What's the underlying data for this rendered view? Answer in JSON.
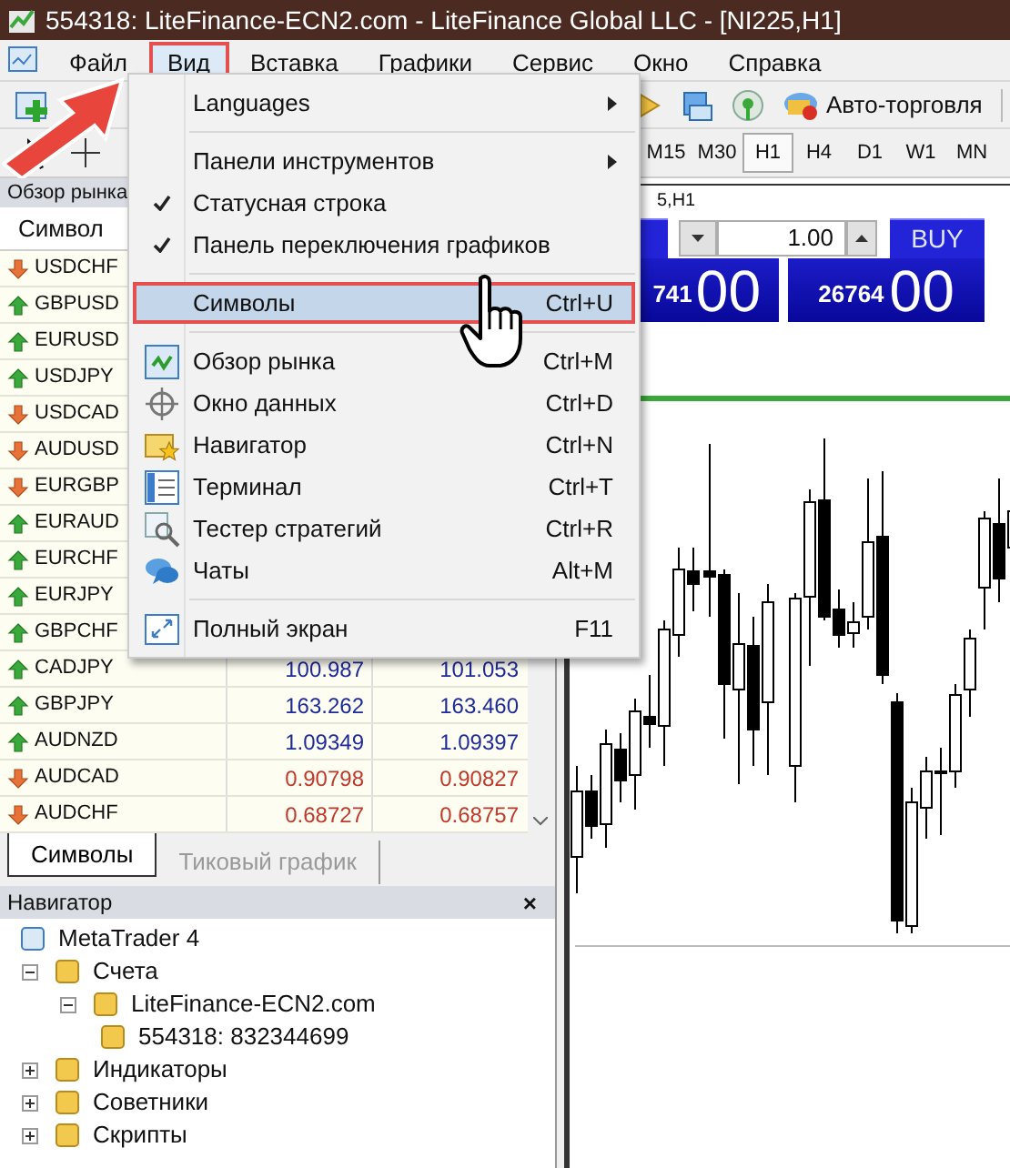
{
  "window": {
    "title": "554318: LiteFinance-ECN2.com - LiteFinance Global LLC - [NI225,H1]"
  },
  "menu_bar": [
    {
      "label": "Файл",
      "selected": false
    },
    {
      "label": "Вид",
      "selected": true
    },
    {
      "label": "Вставка",
      "selected": false
    },
    {
      "label": "Графики",
      "selected": false
    },
    {
      "label": "Сервис",
      "selected": false
    },
    {
      "label": "Окно",
      "selected": false
    },
    {
      "label": "Справка",
      "selected": false
    }
  ],
  "toolbar": {
    "auto_trading": "Авто-торговля"
  },
  "timeframes": [
    {
      "label": "M15",
      "selected": false
    },
    {
      "label": "M30",
      "selected": false
    },
    {
      "label": "H1",
      "selected": true
    },
    {
      "label": "H4",
      "selected": false
    },
    {
      "label": "D1",
      "selected": false
    },
    {
      "label": "W1",
      "selected": false
    },
    {
      "label": "MN",
      "selected": false
    }
  ],
  "view_menu": [
    {
      "kind": "submenu",
      "label": "Languages",
      "selected": false
    },
    {
      "kind": "separator"
    },
    {
      "kind": "submenu",
      "label": "Панели инструментов",
      "selected": false
    },
    {
      "kind": "check",
      "label": "Статусная строка",
      "checked": true,
      "selected": false
    },
    {
      "kind": "check",
      "label": "Панель переключения графиков",
      "checked": true,
      "selected": false
    },
    {
      "kind": "separator"
    },
    {
      "kind": "item",
      "label": "Символы",
      "shortcut": "Ctrl+U",
      "selected": true
    },
    {
      "kind": "separator"
    },
    {
      "kind": "item",
      "label": "Обзор рынка",
      "shortcut": "Ctrl+M",
      "selected": false
    },
    {
      "kind": "item",
      "label": "Окно данных",
      "shortcut": "Ctrl+D",
      "selected": false
    },
    {
      "kind": "item",
      "label": "Навигатор",
      "shortcut": "Ctrl+N",
      "selected": false
    },
    {
      "kind": "item",
      "label": "Терминал",
      "shortcut": "Ctrl+T",
      "selected": false
    },
    {
      "kind": "item",
      "label": "Тестер стратегий",
      "shortcut": "Ctrl+R",
      "selected": false
    },
    {
      "kind": "item",
      "label": "Чаты",
      "shortcut": "Alt+M",
      "selected": false
    },
    {
      "kind": "separator"
    },
    {
      "kind": "item",
      "label": "Полный экран",
      "shortcut": "F11",
      "selected": false
    }
  ],
  "market_watch": {
    "title": "Обзор рынка",
    "columns": [
      "Символ"
    ],
    "rows": [
      {
        "symbol": "USDCHF",
        "kind": "down"
      },
      {
        "symbol": "GBPUSD",
        "kind": "up"
      },
      {
        "symbol": "EURUSD",
        "kind": "up"
      },
      {
        "symbol": "USDJPY",
        "kind": "up"
      },
      {
        "symbol": "USDCAD",
        "kind": "down"
      },
      {
        "symbol": "AUDUSD",
        "kind": "down"
      },
      {
        "symbol": "EURGBP",
        "kind": "down"
      },
      {
        "symbol": "EURAUD",
        "kind": "up"
      },
      {
        "symbol": "EURCHF",
        "kind": "up"
      },
      {
        "symbol": "EURJPY",
        "kind": "up"
      },
      {
        "symbol": "GBPCHF",
        "kind": "up"
      },
      {
        "symbol": "CADJPY",
        "kind": "up",
        "bid": "100.987",
        "ask": "101.053"
      },
      {
        "symbol": "GBPJPY",
        "kind": "up",
        "bid": "163.262",
        "ask": "163.460"
      },
      {
        "symbol": "AUDNZD",
        "kind": "up",
        "bid": "1.09349",
        "ask": "1.09397"
      },
      {
        "symbol": "AUDCAD",
        "kind": "down",
        "bid": "0.90798",
        "ask": "0.90827"
      },
      {
        "symbol": "AUDCHF",
        "kind": "down",
        "bid": "0.68727",
        "ask": "0.68757"
      }
    ]
  },
  "tabs": [
    {
      "label": "Символы",
      "selected": true
    },
    {
      "label": "Тиковый график",
      "selected": false
    }
  ],
  "navigator": {
    "title": "Навигатор",
    "close": "×",
    "tree": [
      {
        "label": "MetaTrader 4",
        "children": [
          {
            "label": "Счета",
            "expanded": true,
            "children": [
              {
                "label": "LiteFinance-ECN2.com",
                "expanded": true,
                "children": [
                  {
                    "label": "554318: 832344699"
                  }
                ]
              }
            ]
          },
          {
            "label": "Индикаторы",
            "expanded": false
          },
          {
            "label": "Советники",
            "expanded": false
          },
          {
            "label": "Скрипты",
            "expanded": false
          }
        ]
      }
    ]
  },
  "chart": {
    "title": "5,H1",
    "trade_panel": {
      "sell_small": "741",
      "sell_big": "00",
      "lots": "1.00",
      "buy_label": "BUY",
      "buy_small": "26764",
      "buy_big": "00"
    }
  }
}
